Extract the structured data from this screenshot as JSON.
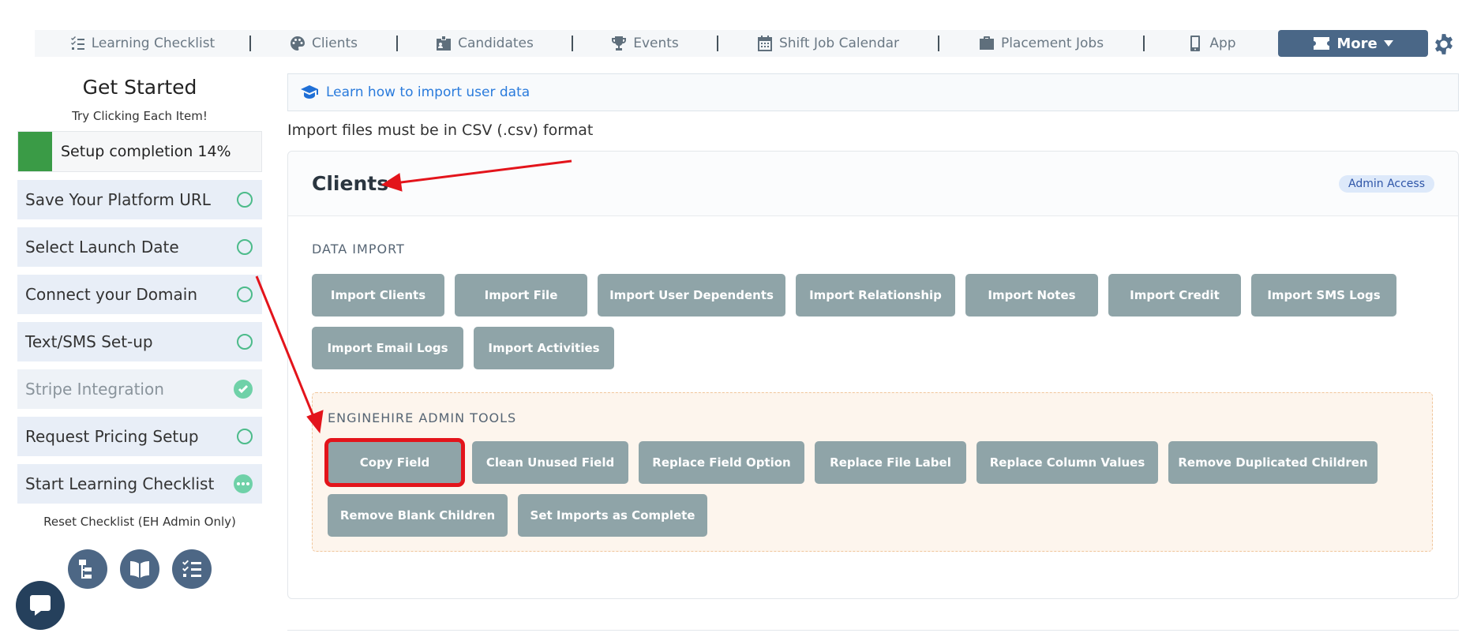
{
  "nav": {
    "items": [
      {
        "label": "Learning Checklist",
        "icon": "checklist-icon"
      },
      {
        "label": "Clients",
        "icon": "palette-icon"
      },
      {
        "label": "Candidates",
        "icon": "id-card-icon"
      },
      {
        "label": "Events",
        "icon": "trophy-icon"
      },
      {
        "label": "Shift Job Calendar",
        "icon": "calendar-icon"
      },
      {
        "label": "Placement Jobs",
        "icon": "briefcase-icon"
      },
      {
        "label": "App",
        "icon": "mobile-icon"
      }
    ],
    "more_label": "More"
  },
  "sidebar": {
    "title": "Get Started",
    "subtitle": "Try Clicking Each Item!",
    "progress_label": "Setup completion 14%",
    "progress_value": 14,
    "items": [
      {
        "label": "Save Your Platform URL",
        "status": "pending"
      },
      {
        "label": "Select Launch Date",
        "status": "pending"
      },
      {
        "label": "Connect your Domain",
        "status": "pending"
      },
      {
        "label": "Text/SMS Set-up",
        "status": "pending"
      },
      {
        "label": "Stripe Integration",
        "status": "done"
      },
      {
        "label": "Request Pricing Setup",
        "status": "pending"
      },
      {
        "label": "Start Learning Checklist",
        "status": "in-progress"
      }
    ],
    "reset_label": "Reset Checklist (EH Admin Only)"
  },
  "main": {
    "learn_link": "Learn how to import user data",
    "csv_note": "Import files must be in CSV (.csv) format",
    "card_title": "Clients",
    "badge": "Admin Access",
    "data_import_label": "DATA IMPORT",
    "data_import_buttons": [
      "Import Clients",
      "Import File",
      "Import User Dependents",
      "Import Relationship",
      "Import Notes",
      "Import Credit",
      "Import SMS Logs",
      "Import Email Logs",
      "Import Activities"
    ],
    "admin_tools_label": "ENGINEHIRE ADMIN TOOLS",
    "admin_tools_buttons": [
      "Copy Field",
      "Clean Unused Field",
      "Replace Field Option",
      "Replace File Label",
      "Replace Column Values",
      "Remove Duplicated Children",
      "Remove Blank Children",
      "Set Imports as Complete"
    ]
  },
  "colors": {
    "accent": "#4a6787",
    "button": "#8fa4a8",
    "success": "#3a9b46",
    "annotation": "#e3141b"
  }
}
